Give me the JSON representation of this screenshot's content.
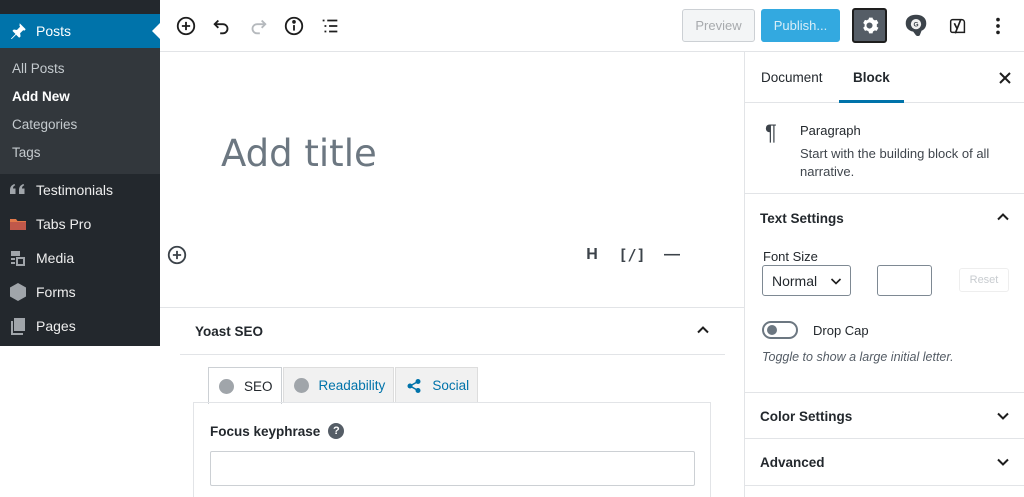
{
  "sidebar": {
    "posts_label": "Posts",
    "submenu": [
      "All Posts",
      "Add New",
      "Categories",
      "Tags"
    ],
    "items": [
      {
        "label": "Testimonials",
        "icon": "quote-icon"
      },
      {
        "label": "Tabs Pro",
        "icon": "tabs-icon"
      },
      {
        "label": "Media",
        "icon": "media-icon"
      },
      {
        "label": "Forms",
        "icon": "forms-icon"
      },
      {
        "label": "Pages",
        "icon": "pages-icon"
      }
    ]
  },
  "toolbar": {
    "preview_label": "Preview",
    "publish_label": "Publish...",
    "icons": [
      "add-block-icon",
      "undo-icon",
      "redo-icon",
      "info-icon",
      "outline-icon",
      "settings-gear-icon",
      "gravatar-icon",
      "yoast-icon",
      "more-options-icon"
    ],
    "colors": {
      "publish_bg": "#33a9e0",
      "admin_bg": "#23282d",
      "active_blue": "#0073aa"
    }
  },
  "editor": {
    "title_placeholder": "Add title",
    "format_buttons": [
      "H",
      "[/]",
      "—"
    ]
  },
  "yoast": {
    "panel_title": "Yoast SEO",
    "tabs": [
      "SEO",
      "Readability",
      "Social"
    ],
    "focus_label": "Focus keyphrase",
    "help_glyph": "?"
  },
  "settings": {
    "tabs": [
      "Document",
      "Block"
    ],
    "active_tab": "Block",
    "block_name": "Paragraph",
    "block_description": "Start with the building block of all narrative.",
    "text_settings": {
      "title": "Text Settings",
      "font_size_label": "Font Size",
      "font_size_value": "Normal",
      "reset_label": "Reset",
      "drop_cap_label": "Drop Cap",
      "drop_cap_help": "Toggle to show a large initial letter."
    },
    "color_settings_title": "Color Settings",
    "advanced_title": "Advanced"
  }
}
